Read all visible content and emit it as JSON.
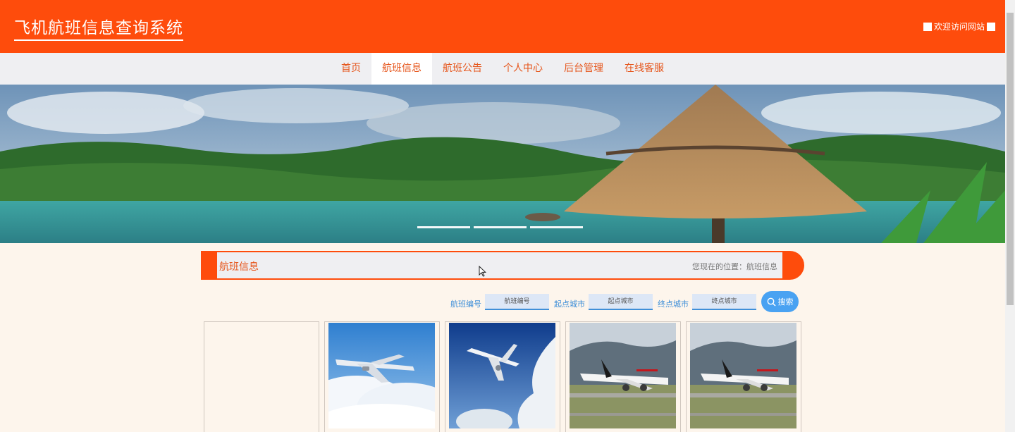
{
  "header": {
    "title": "飞机航班信息查询系统",
    "welcome": "欢迎访问网站"
  },
  "nav": [
    {
      "label": "首页",
      "active": false
    },
    {
      "label": "航班信息",
      "active": true
    },
    {
      "label": "航班公告",
      "active": false
    },
    {
      "label": "个人中心",
      "active": false
    },
    {
      "label": "后台管理",
      "active": false
    },
    {
      "label": "在线客服",
      "active": false
    }
  ],
  "banner": {
    "slides": 3,
    "active_slide": 1
  },
  "section": {
    "title": "航班信息",
    "location": "您现在的位置：航班信息"
  },
  "search": {
    "flight_no_label": "航班编号",
    "flight_no_placeholder": "航班编号",
    "from_label": "起点城市",
    "from_placeholder": "起点城市",
    "to_label": "终点城市",
    "to_placeholder": "终点城市",
    "button_label": "搜索"
  },
  "cards": [
    {
      "image": "empty"
    },
    {
      "image": "airplane-clouds"
    },
    {
      "image": "airplane-sky"
    },
    {
      "image": "air-canada-plane"
    },
    {
      "image": "air-canada-plane"
    }
  ],
  "colors": {
    "brand": "#fe4c0c",
    "nav_text": "#e6561c",
    "search_blue": "#49a2f2",
    "page_bg": "#fdf5ec"
  }
}
